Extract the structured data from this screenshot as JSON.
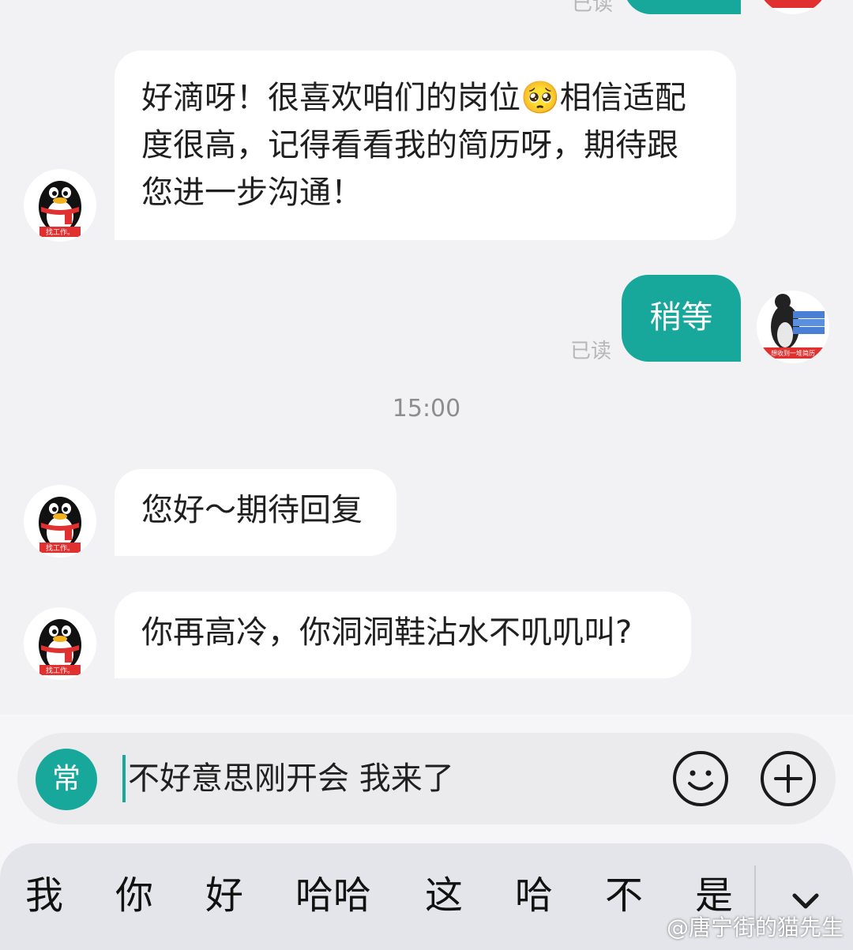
{
  "chat": {
    "messages": [
      {
        "side": "left",
        "text": "好滴呀！很喜欢咱们的岗位🥺相信适配度很高，记得看看我的简历呀，期待跟您进一步沟通！"
      },
      {
        "side": "right",
        "text": "稍等",
        "status": "已读"
      },
      {
        "side": "left",
        "text": "您好～期待回复"
      },
      {
        "side": "left",
        "text": "你再高冷，你洞洞鞋沾水不叽叽叫?"
      }
    ],
    "top_status": "已读",
    "timestamp": "15:00",
    "left_avatar_caption": "找工作。",
    "right_avatar_caption": "想收到一堆简历"
  },
  "input": {
    "quick_phrase_label": "常",
    "text": "不好意思刚开会 我来了",
    "emoji_icon": "smiley-icon",
    "plus_icon": "plus-icon"
  },
  "keyboard": {
    "candidates": [
      "我",
      "你",
      "好",
      "哈哈",
      "这",
      "哈",
      "不",
      "是"
    ],
    "collapse_icon": "chevron-down-icon"
  },
  "watermark": "@唐宁街的猫先生",
  "colors": {
    "accent": "#17a79b",
    "bubble_left": "#ffffff",
    "background": "#f2f2f4"
  }
}
